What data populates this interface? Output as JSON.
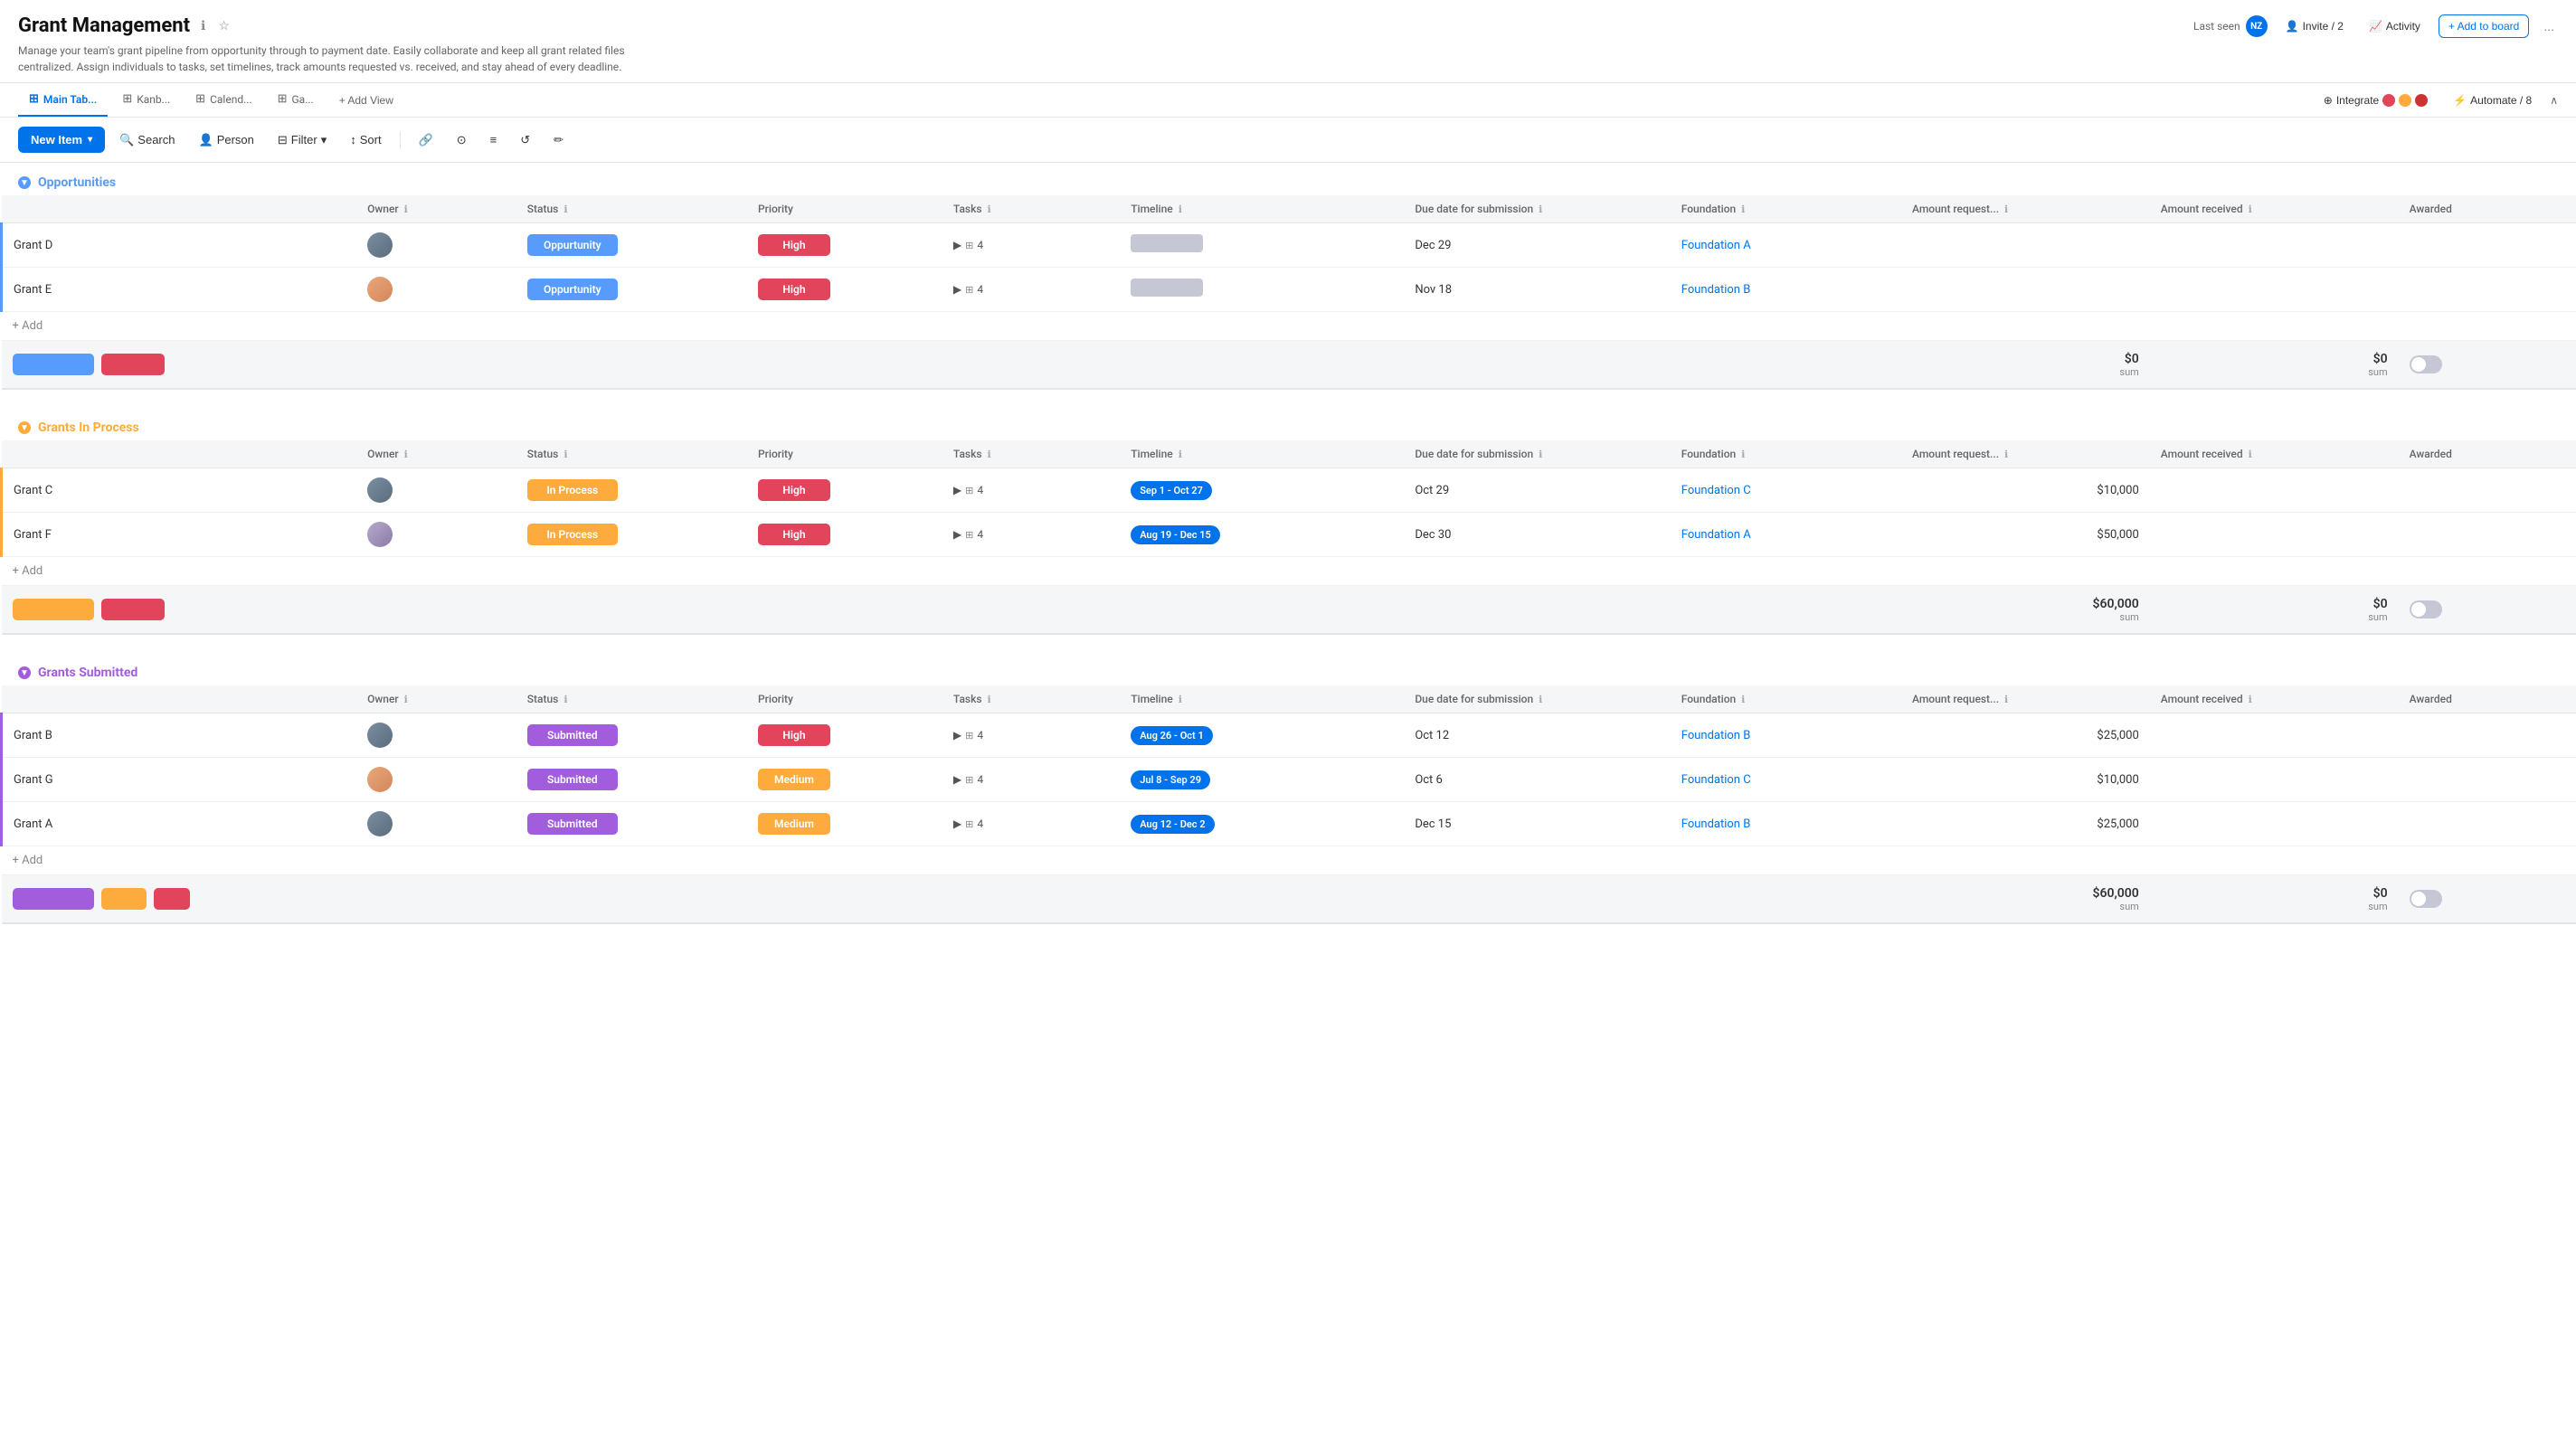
{
  "header": {
    "title": "Grant Management",
    "subtitle": "Manage your team's grant pipeline from opportunity through to payment date. Easily collaborate and keep all grant related files centralized. Assign individuals to tasks, set timelines, track amounts requested vs. received, and stay ahead of every deadline.",
    "last_seen_label": "Last seen",
    "avatar_initials": "NZ",
    "invite_label": "Invite / 2",
    "activity_label": "Activity",
    "add_board_label": "+ Add to board",
    "more_label": "..."
  },
  "tabs": [
    {
      "id": "main",
      "label": "Main Tab...",
      "icon": "⊞",
      "active": true
    },
    {
      "id": "kanban",
      "label": "Kanb...",
      "icon": "⊞",
      "active": false
    },
    {
      "id": "calendar",
      "label": "Calend...",
      "icon": "⊞",
      "active": false
    },
    {
      "id": "gantt",
      "label": "Ga...",
      "icon": "⊞",
      "active": false
    }
  ],
  "add_view_label": "+ Add View",
  "integrate_label": "Integrate",
  "automate_label": "Automate / 8",
  "toolbar": {
    "new_item_label": "New Item",
    "search_label": "Search",
    "person_label": "Person",
    "filter_label": "Filter",
    "sort_label": "Sort",
    "tools": [
      "🔗",
      "⊙",
      "≡",
      "↺",
      "✏"
    ]
  },
  "columns": {
    "owner": "Owner",
    "status": "Status",
    "priority": "Priority",
    "tasks": "Tasks",
    "timeline": "Timeline",
    "due_date": "Due date for submission",
    "foundation": "Foundation",
    "amount_req": "Amount request...",
    "amount_rec": "Amount received",
    "awarded": "Awarded"
  },
  "sections": [
    {
      "id": "opportunities",
      "title": "Opportunities",
      "color_class": "opportunities",
      "dot_class": "dot-opportunity",
      "border_color": "#579bfc",
      "items": [
        {
          "name": "Grant D",
          "owner_type": "male",
          "status": "Oppurtunity",
          "status_class": "status-opportunity",
          "priority": "High",
          "priority_class": "priority-high",
          "tasks": "4",
          "timeline": "gray",
          "timeline_label": "-",
          "due_date": "Dec 29",
          "foundation": "Foundation A",
          "amount_req": "",
          "amount_rec": ""
        },
        {
          "name": "Grant E",
          "owner_type": "female",
          "status": "Oppurtunity",
          "status_class": "status-opportunity",
          "priority": "High",
          "priority_class": "priority-high",
          "tasks": "4",
          "timeline": "gray",
          "timeline_label": "-",
          "due_date": "Nov 18",
          "foundation": "Foundation B",
          "amount_req": "",
          "amount_rec": ""
        }
      ],
      "summary": {
        "amount_req": "$0",
        "amount_rec": "$0"
      },
      "status_pills": [
        "blue",
        "red"
      ]
    },
    {
      "id": "grants-in-process",
      "title": "Grants In Process",
      "color_class": "in-process",
      "dot_class": "dot-inprocess",
      "border_color": "#fdab3d",
      "items": [
        {
          "name": "Grant C",
          "owner_type": "male",
          "status": "In Process",
          "status_class": "status-inprocess",
          "priority": "High",
          "priority_class": "priority-high",
          "tasks": "4",
          "timeline": "blue",
          "timeline_label": "Sep 1 - Oct 27",
          "due_date": "Oct 29",
          "foundation": "Foundation C",
          "amount_req": "$10,000",
          "amount_rec": ""
        },
        {
          "name": "Grant F",
          "owner_type": "female2",
          "status": "In Process",
          "status_class": "status-inprocess",
          "priority": "High",
          "priority_class": "priority-high",
          "tasks": "4",
          "timeline": "blue",
          "timeline_label": "Aug 19 - Dec 15",
          "due_date": "Dec 30",
          "foundation": "Foundation A",
          "amount_req": "$50,000",
          "amount_rec": ""
        }
      ],
      "summary": {
        "amount_req": "$60,000",
        "amount_rec": "$0"
      },
      "status_pills": [
        "orange",
        "red"
      ]
    },
    {
      "id": "grants-submitted",
      "title": "Grants Submitted",
      "color_class": "submitted",
      "dot_class": "dot-submitted",
      "border_color": "#a25ddc",
      "items": [
        {
          "name": "Grant B",
          "owner_type": "male",
          "status": "Submitted",
          "status_class": "status-submitted",
          "priority": "High",
          "priority_class": "priority-high",
          "tasks": "4",
          "timeline": "blue",
          "timeline_label": "Aug 26 - Oct 1",
          "due_date": "Oct 12",
          "foundation": "Foundation B",
          "amount_req": "$25,000",
          "amount_rec": ""
        },
        {
          "name": "Grant G",
          "owner_type": "female",
          "status": "Submitted",
          "status_class": "status-submitted",
          "priority": "Medium",
          "priority_class": "priority-medium",
          "tasks": "4",
          "timeline": "blue",
          "timeline_label": "Jul 8 - Sep 29",
          "due_date": "Oct 6",
          "foundation": "Foundation C",
          "amount_req": "$10,000",
          "amount_rec": ""
        },
        {
          "name": "Grant A",
          "owner_type": "male",
          "status": "Submitted",
          "status_class": "status-submitted",
          "priority": "Medium",
          "priority_class": "priority-medium",
          "tasks": "4",
          "timeline": "blue",
          "timeline_label": "Aug 12 - Dec 2",
          "due_date": "Dec 15",
          "foundation": "Foundation B",
          "amount_req": "$25,000",
          "amount_rec": ""
        }
      ],
      "summary": {
        "amount_req": "$60,000",
        "amount_rec": "$0"
      },
      "status_pills": [
        "purple",
        "orange",
        "red"
      ]
    }
  ],
  "add_row_label": "+ Add",
  "sum_label": "sum"
}
